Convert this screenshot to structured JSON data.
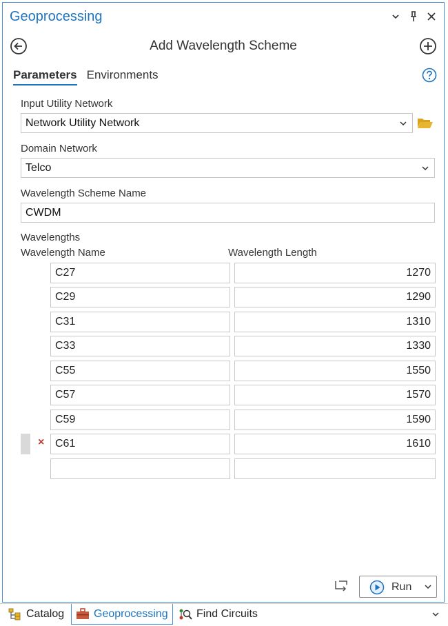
{
  "window": {
    "title": "Geoprocessing"
  },
  "tool": {
    "title": "Add Wavelength Scheme"
  },
  "tabs": [
    {
      "label": "Parameters",
      "active": true
    },
    {
      "label": "Environments",
      "active": false
    }
  ],
  "params": {
    "input_network_label": "Input Utility Network",
    "input_network_value": "Network Utility Network",
    "domain_label": "Domain Network",
    "domain_value": "Telco",
    "scheme_name_label": "Wavelength Scheme Name",
    "scheme_name_value": "CWDM",
    "wavelengths_label": "Wavelengths",
    "col_name": "Wavelength Name",
    "col_length": "Wavelength Length",
    "rows": [
      {
        "name": "C27",
        "length": "1270"
      },
      {
        "name": "C29",
        "length": "1290"
      },
      {
        "name": "C31",
        "length": "1310"
      },
      {
        "name": "C33",
        "length": "1330"
      },
      {
        "name": "C55",
        "length": "1550"
      },
      {
        "name": "C57",
        "length": "1570"
      },
      {
        "name": "C59",
        "length": "1590"
      },
      {
        "name": "C61",
        "length": "1610"
      },
      {
        "name": "",
        "length": ""
      }
    ]
  },
  "actions": {
    "run_label": "Run",
    "delete_glyph": "×"
  },
  "bottom_tabs": [
    {
      "label": "Catalog",
      "icon": "catalog-icon"
    },
    {
      "label": "Geoprocessing",
      "icon": "toolbox-icon"
    },
    {
      "label": "Find Circuits",
      "icon": "find-circuits-icon"
    }
  ],
  "colors": {
    "accent": "#1e73be",
    "border": "#4a90d9",
    "delete": "#c0392b",
    "folder": "#e8b530"
  }
}
